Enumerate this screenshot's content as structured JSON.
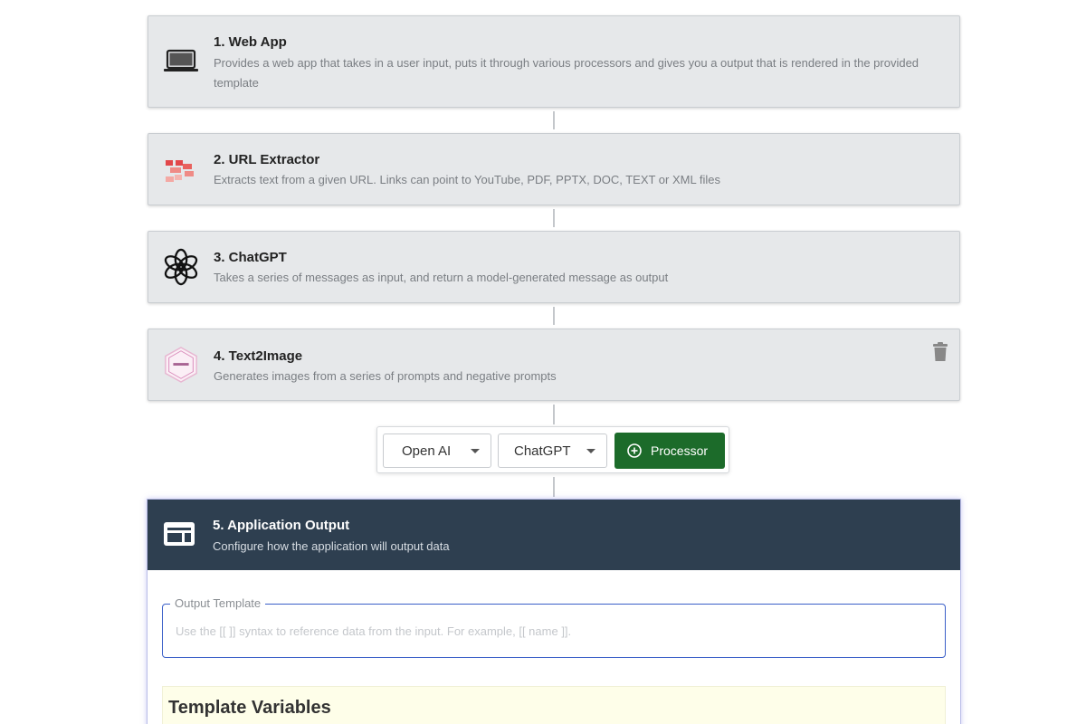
{
  "steps": [
    {
      "title": "1. Web App",
      "description": "Provides a web app that takes in a user input, puts it through various processors and gives you a output that is rendered in the provided template",
      "icon": "laptop-icon"
    },
    {
      "title": "2. URL Extractor",
      "description": "Extracts text from a given URL. Links can point to YouTube, PDF, PPTX, DOC, TEXT or XML files",
      "icon": "url-extractor-icon"
    },
    {
      "title": "3. ChatGPT",
      "description": "Takes a series of messages as input, and return a model-generated message as output",
      "icon": "openai-icon"
    },
    {
      "title": "4. Text2Image",
      "description": "Generates images from a series of prompts and negative prompts",
      "icon": "text2image-icon",
      "delete_icon": "trash-icon"
    }
  ],
  "toolbar": {
    "provider_select": "Open AI",
    "processor_select": "ChatGPT",
    "add_button_label": "Processor"
  },
  "output": {
    "title": "5. Application Output",
    "description": "Configure how the application will output data",
    "icon": "output-layout-icon",
    "template_label": "Output Template",
    "template_placeholder": "Use the [[ ]] syntax to reference data from the input. For example, [[ name ]].",
    "template_value": "",
    "variables_title": "Template Variables"
  },
  "colors": {
    "card_bg": "#e6e8ea",
    "output_header_bg": "#2e3f50",
    "add_button_bg": "#1c6b2a",
    "field_border": "#3a5fc8",
    "variables_bg": "#fefee9"
  }
}
